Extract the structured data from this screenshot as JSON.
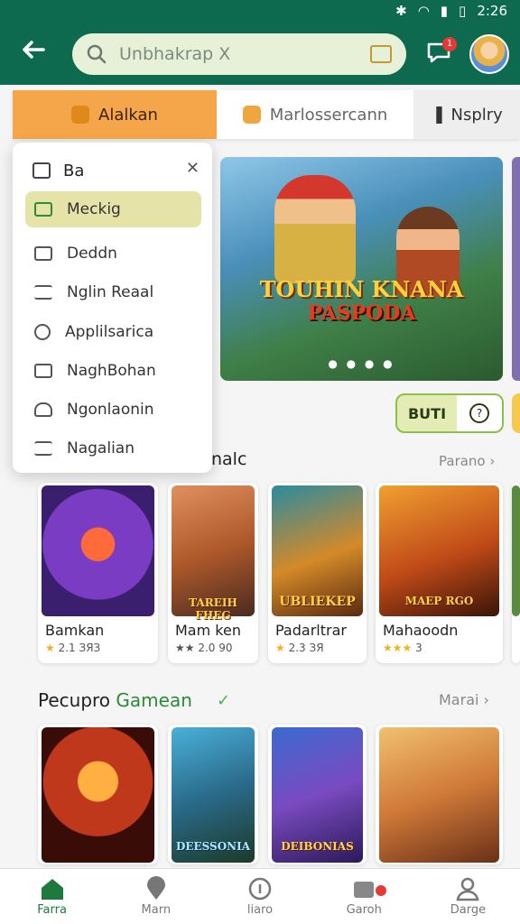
{
  "status": {
    "time": "2:26"
  },
  "search": {
    "placeholder": "Unbhakrap X"
  },
  "header": {
    "notification_count": "1"
  },
  "tabs": [
    {
      "label": "Alalkan"
    },
    {
      "label": "Marlossercann"
    },
    {
      "label": "Nsplry"
    }
  ],
  "menu": {
    "header": "Ba",
    "items": [
      {
        "label": "Meckig",
        "selected": true
      },
      {
        "label": "Deddn"
      },
      {
        "label": "Nglin Reaal"
      },
      {
        "label": "Applilsarica"
      },
      {
        "label": "NaghBohan"
      },
      {
        "label": "Ngonlaonin"
      },
      {
        "label": "Nagalian"
      }
    ]
  },
  "banner": {
    "title": "TOUHIN KNANA",
    "subtitle": "PASPODA"
  },
  "actions": {
    "primary": "BUTI"
  },
  "section1": {
    "title": "nalc",
    "more": "Parano",
    "cards": [
      {
        "name": "Bamkan",
        "rating": "2.1",
        "extra": "ЗЯЗ"
      },
      {
        "name": "Mam ken",
        "rating": "★★ 2.0",
        "extra": "90"
      },
      {
        "name": "Padarltrar",
        "rating": "2.3",
        "extra": "ЗЯ"
      },
      {
        "name": "Mahaoodn",
        "rating": "3",
        "extra": ""
      }
    ],
    "art_labels": [
      "",
      "TAREIH FHEG",
      "UBLIEKEP",
      "MAEP RGO"
    ]
  },
  "section2": {
    "title_a": "Pecupro",
    "title_b": "Gamean",
    "more": "Marai",
    "art_labels": [
      "",
      "DEESSONIA",
      "DEIBONIAS",
      ""
    ]
  },
  "nav": [
    {
      "label": "Farra"
    },
    {
      "label": "Marn"
    },
    {
      "label": "liaro"
    },
    {
      "label": "Garoh"
    },
    {
      "label": "Darge"
    }
  ],
  "colors": {
    "primary": "#0e6a4e",
    "accent": "#f5a64b",
    "highlight": "#e6e3a8"
  }
}
